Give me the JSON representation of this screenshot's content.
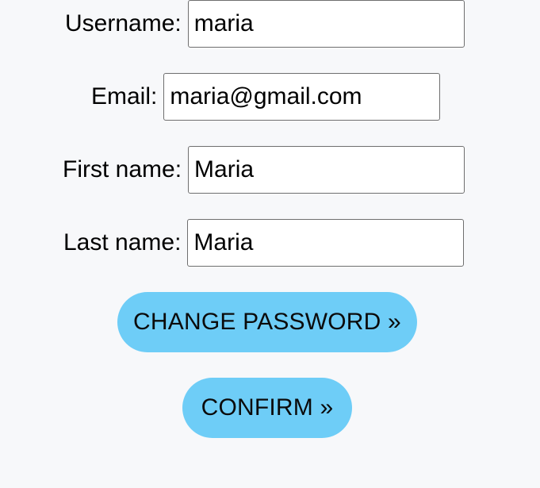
{
  "form": {
    "username": {
      "label": "Username:",
      "value": "maria"
    },
    "email": {
      "label": "Email:",
      "value": "maria@gmail.com"
    },
    "first_name": {
      "label": "First name:",
      "value": "Maria"
    },
    "last_name": {
      "label": "Last name:",
      "value": "Maria"
    }
  },
  "actions": {
    "change_password_label": "CHANGE PASSWORD »",
    "confirm_label": "CONFIRM »"
  },
  "colors": {
    "background": "#f7f8fa",
    "button": "#6ecdf7",
    "input_border": "#6f6f6f"
  }
}
